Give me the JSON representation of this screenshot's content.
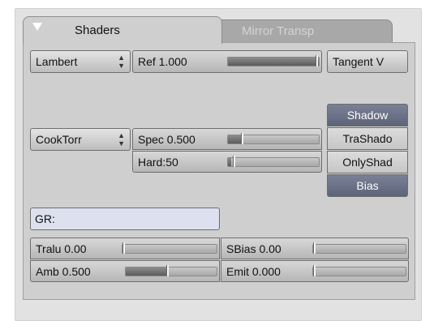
{
  "tabs": [
    {
      "label": "Shaders",
      "active": true
    },
    {
      "label": "Mirror Transp",
      "active": false
    }
  ],
  "diffuse_shader": {
    "value": "Lambert"
  },
  "ref": {
    "label": "Ref  1.000",
    "value": 1.0
  },
  "tangent_button": {
    "label": "Tangent V"
  },
  "specular_shader": {
    "value": "CookTorr"
  },
  "spec": {
    "label": "Spec 0.500",
    "value": 0.5
  },
  "hard": {
    "label": "Hard:50",
    "value": 50
  },
  "shadow_buttons": [
    {
      "label": "Shadow",
      "active": true
    },
    {
      "label": "TraShado",
      "active": false
    },
    {
      "label": "OnlyShad",
      "active": false
    },
    {
      "label": "Bias",
      "active": true
    }
  ],
  "group_field": {
    "label": "GR:"
  },
  "tralu": {
    "label": "Tralu 0.00",
    "value": 0.0
  },
  "sbias": {
    "label": "SBias 0.00",
    "value": 0.0
  },
  "amb": {
    "label": "Amb 0.500",
    "value": 0.5
  },
  "emit": {
    "label": "Emit 0.000",
    "value": 0.0
  },
  "colors": {
    "active_toggle": "#6a7085",
    "panel": "#cfcfcf",
    "text_field": "#dde0ef"
  }
}
